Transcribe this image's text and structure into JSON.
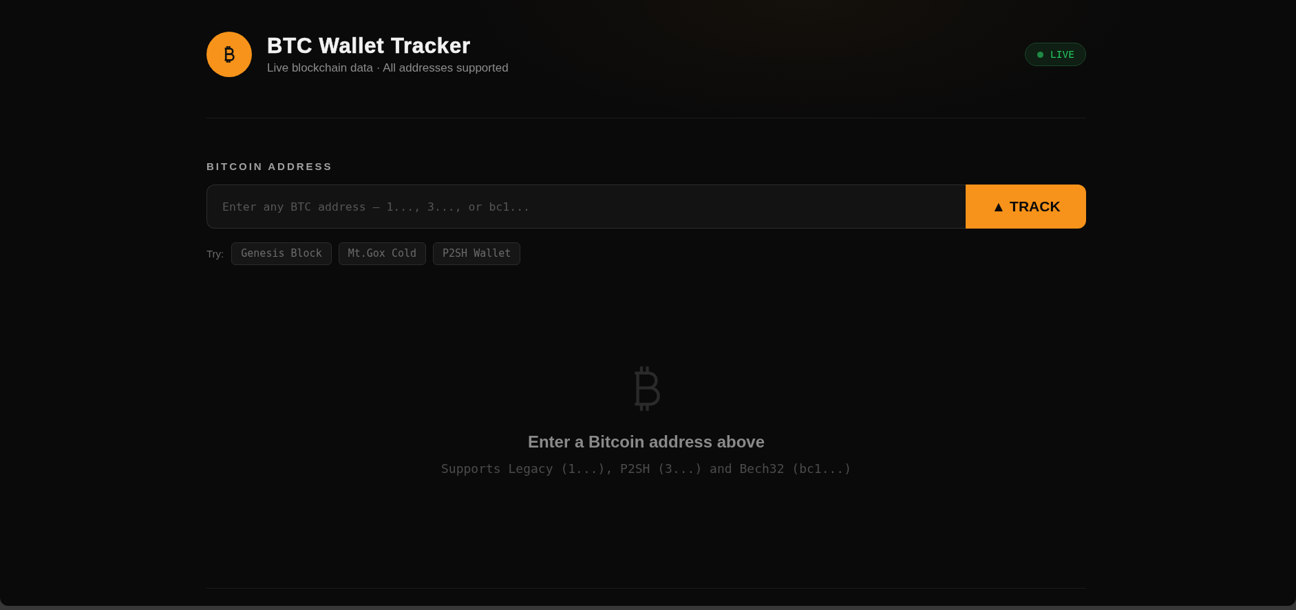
{
  "header": {
    "title": "BTC Wallet Tracker",
    "subtitle": "Live blockchain data · All addresses supported",
    "status_badge": {
      "label": "LIVE"
    }
  },
  "address_form": {
    "label": "BITCOIN ADDRESS",
    "placeholder": "Enter any BTC address — 1..., 3..., or bc1...",
    "button": "▲ TRACK"
  },
  "examples": {
    "label": "Try:",
    "items": [
      "Genesis Block",
      "Mt.Gox Cold",
      "P2SH Wallet"
    ]
  },
  "empty_state": {
    "title": "Enter a Bitcoin address above",
    "subtitle": "Supports Legacy (1...), P2SH (3...) and Bech32 (bc1...)"
  }
}
